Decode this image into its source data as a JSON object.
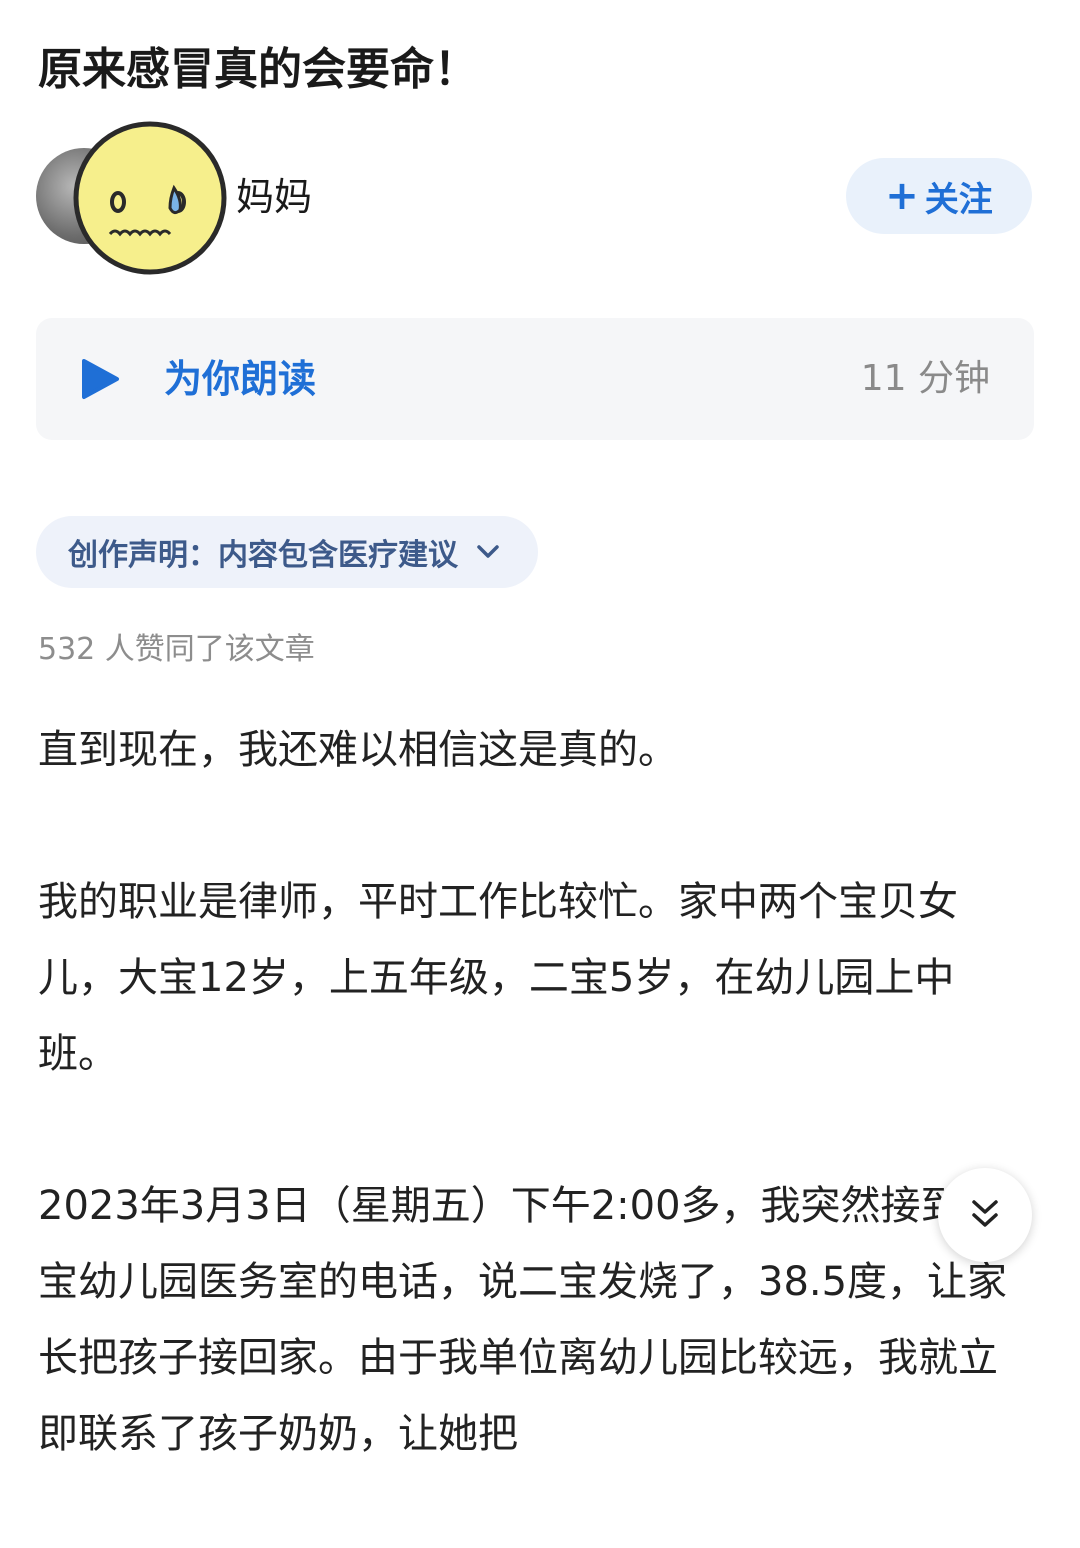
{
  "article": {
    "title": "原来感冒真的会要命！"
  },
  "author": {
    "name": "妈妈",
    "follow_label": "关注",
    "follow_icon": "plus-icon"
  },
  "audio": {
    "label": "为你朗读",
    "duration": "11 分钟",
    "icon": "play-icon"
  },
  "disclaimer": {
    "text": "创作声明：内容包含医疗建议",
    "icon": "chevron-down-icon"
  },
  "likes": {
    "text": "532 人赞同了该文章"
  },
  "body": {
    "paragraphs": [
      "直到现在，我还难以相信这是真的。",
      "我的职业是律师，平时工作比较忙。家中两个宝贝女儿，大宝12岁，上五年级，二宝5岁，在幼儿园上中班。",
      "2023年3月3日（星期五）下午2:00多，我突然接到二宝幼儿园医务室的电话，说二宝发烧了，38.5度，让家长把孩子接回家。由于我单位离幼儿园比较远，我就立即联系了孩子奶奶，让她把"
    ]
  },
  "scroll_button": {
    "icon": "double-chevron-down-icon"
  },
  "colors": {
    "accent": "#1f6fd6",
    "card_bg": "#f5f6f8",
    "pill_bg": "#eef2fa",
    "muted_text": "#8d8d8d"
  }
}
